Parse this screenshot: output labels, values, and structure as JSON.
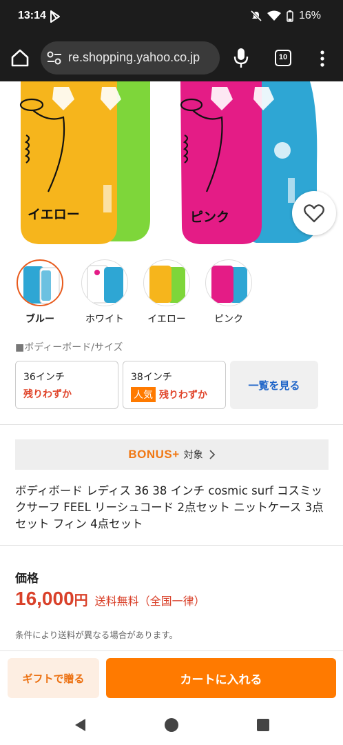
{
  "status_bar": {
    "time": "13:14",
    "battery": "16%"
  },
  "browser": {
    "url": "re.shopping.yahoo.co.jp",
    "tab_count": "10"
  },
  "hero": {
    "left_board_label": "イエロー",
    "right_board_label": "ピンク"
  },
  "variants": [
    {
      "label": "ブルー",
      "selected": true
    },
    {
      "label": "ホワイト",
      "selected": false
    },
    {
      "label": "イエロー",
      "selected": false
    },
    {
      "label": "ピンク",
      "selected": false
    }
  ],
  "size_section": {
    "heading": "■ボディーボード/サイズ",
    "options": [
      {
        "name": "36インチ",
        "stock": "残りわずか"
      },
      {
        "name": "38インチ",
        "badge": "人気",
        "stock": "残りわずか"
      }
    ],
    "view_all": "一覧を見る"
  },
  "bonus": {
    "logo": "BONUS+",
    "target": "対象"
  },
  "product": {
    "title": "ボディボード レディス 36 38 インチ cosmic surf コスミックサーフ FEEL リーシュコード 2点セット ニットケース 3点セット フィン 4点セット"
  },
  "price": {
    "heading": "価格",
    "value": "16,000",
    "unit": "円",
    "shipping": "送料無料（全国一律）",
    "note": "条件により送料が異なる場合があります。"
  },
  "actions": {
    "gift": "ギフトで贈る",
    "cart": "カートに入れる"
  },
  "colors": {
    "accent_orange": "#ff7a00",
    "price_red": "#d9412a",
    "link_blue": "#1e64c8"
  }
}
